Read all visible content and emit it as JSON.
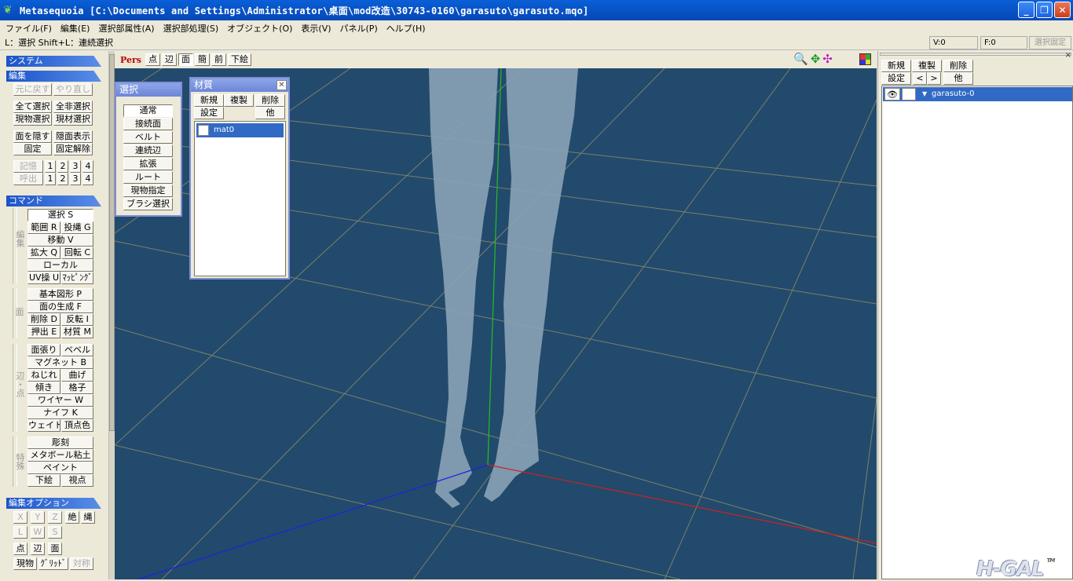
{
  "window": {
    "title": "Metasequoia [C:\\Documents and Settings\\Administrator\\桌面\\mod改造\\30743-0160\\garasuto\\garasuto.mqo]",
    "minimize": "_",
    "restore": "❐",
    "close": "✕"
  },
  "menu": [
    "ファイル(F)",
    "編集(E)",
    "選択部属性(A)",
    "選択部処理(S)",
    "オブジェクト(O)",
    "表示(V)",
    "パネル(P)",
    "ヘルプ(H)"
  ],
  "hint": {
    "text": "L：選択 Shift+L：連続選択",
    "vertices": "V:0",
    "faces": "F:0",
    "select_fix": "選択固定"
  },
  "left": {
    "system_label": "システム",
    "edit_label": "編集",
    "undo": "元に戻す",
    "redo": "やり直し",
    "select_all": "全て選択",
    "deselect_all": "全非選択",
    "obj_select": "現物選択",
    "mat_select": "現材選択",
    "hide_face": "面を隠す",
    "show_hidden": "隠面表示",
    "fix": "固定",
    "unfix": "固定解除",
    "memory": "記憶",
    "recall": "呼出",
    "slot_1": "1",
    "slot_2": "2",
    "slot_3": "3",
    "slot_4": "4",
    "command_label": "コマンド",
    "group_edit": "編集",
    "select_s": "選択 S",
    "range_r": "範囲 R",
    "lasso_g": "投縄 G",
    "move_v": "移動 V",
    "scale_q": "拡大 Q",
    "rotate_c": "回転 C",
    "local": "ローカル",
    "uv_u": "UV操 U",
    "mapping": "ﾏｯﾋﾟﾝｸﾞ",
    "group_face": "面",
    "primitive_p": "基本図形 P",
    "face_gen_f": "面の生成 F",
    "delete_d": "削除 D",
    "invert_i": "反転 I",
    "extrude_e": "押出 E",
    "material_m": "材質 M",
    "group_edge": "辺・点",
    "face_stretch": "面張り",
    "bevel": "ベベル",
    "magnet_b": "マグネット B",
    "twist": "ねじれ",
    "bend": "曲げ",
    "tilt": "傾き",
    "lattice": "格子",
    "wire_w": "ワイヤー W",
    "knife_k": "ナイフ K",
    "weight": "ウェイト",
    "vertex_color": "頂点色",
    "group_special": "特殊",
    "sculpt": "彫刻",
    "metaball": "メタボール粘土",
    "paint": "ペイント",
    "underlay": "下絵",
    "viewpoint": "視点",
    "option_label": "編集オプション",
    "x": "X",
    "y": "Y",
    "z": "Z",
    "absolute": "絶",
    "rope": "縄",
    "l": "L",
    "w": "W",
    "s": "S",
    "pt": "点",
    "edge": "辺",
    "face": "面",
    "cur_obj": "現物",
    "grid": "ｸﾞﾘｯﾄﾞ",
    "symmetry": "対称"
  },
  "viewport": {
    "pers": "Pers",
    "mode_point": "点",
    "mode_edge": "辺",
    "mode_face": "面",
    "simple": "簡",
    "front": "前",
    "underlay": "下絵",
    "zoom_icon": "🔍",
    "move_icon": "✥",
    "rotate_icon": "✣"
  },
  "select_panel": {
    "title": "選択",
    "items": [
      "通常",
      "接続面",
      "ベルト",
      "連続辺",
      "拡張",
      "ルート",
      "現物指定",
      "ブラシ選択"
    ]
  },
  "material_panel": {
    "title": "材質",
    "new": "新規",
    "copy": "複製",
    "delete": "削除",
    "settings": "設定",
    "other": "他",
    "close": "✕",
    "materials": [
      "mat0"
    ]
  },
  "object_panel": {
    "new": "新規",
    "copy": "複製",
    "delete": "削除",
    "settings": "設定",
    "prev": "<",
    "next": ">",
    "other": "他",
    "close": "×",
    "objects": [
      "garasuto-0"
    ],
    "eye": "👁",
    "logo": "H-GAL",
    "logo_tm": "TM"
  },
  "colors": {
    "scene_bg": "#224a6c",
    "grid": "#8a8a6a",
    "axis_x": "#d02020",
    "axis_y": "#20c020",
    "axis_z": "#2020e0",
    "selection": "#316ac5"
  }
}
